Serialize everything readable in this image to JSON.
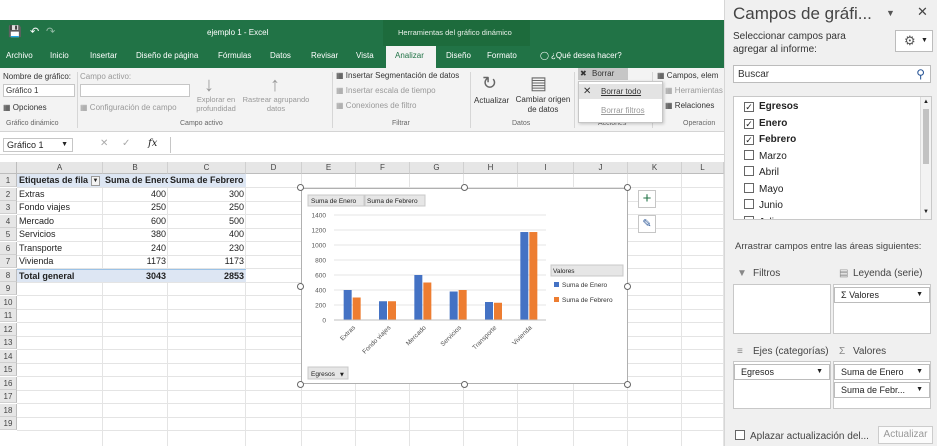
{
  "titlebar": {
    "doc": "ejemplo 1 - Excel",
    "context": "Herramientas del gráfico dinámico"
  },
  "tabs": [
    "Archivo",
    "Inicio",
    "Insertar",
    "Diseño de página",
    "Fórmulas",
    "Datos",
    "Revisar",
    "Vista",
    "Analizar",
    "Diseño",
    "Formato"
  ],
  "tell_me": "¿Qué desea hacer?",
  "ribbon": {
    "chart_name_label": "Nombre de gráfico:",
    "chart_name": "Gráfico 1",
    "options": "Opciones",
    "group_chart": "Gráfico dinámico",
    "active_field_label": "Campo activo:",
    "field_config": "Configuración de campo",
    "explore_down": "Explorar en profundidad",
    "explore_up": "Rastrear agrupando datos",
    "group_active": "Campo activo",
    "slicer": "Insertar Segmentación de datos",
    "timeline": "Insertar escala de tiempo",
    "filter_conn": "Conexiones de filtro",
    "group_filter": "Filtrar",
    "refresh": "Actualizar",
    "change_source": "Cambiar origen de datos",
    "group_data": "Datos",
    "clear": "Borrar",
    "clear_all": "Borrar todo",
    "clear_filters": "Borrar filtros",
    "group_actions": "Acciones",
    "fields_items": "Campos, elem",
    "olap": "Herramientas O",
    "relations": "Relaciones",
    "group_calc": "Operacion"
  },
  "formula": {
    "namebox": "Gráfico 1",
    "fx": "fx"
  },
  "columns": [
    "A",
    "B",
    "C",
    "D",
    "E",
    "F",
    "G",
    "H",
    "I",
    "J",
    "K",
    "L"
  ],
  "rows": [
    "1",
    "2",
    "3",
    "4",
    "5",
    "6",
    "7",
    "8",
    "9",
    "10",
    "11",
    "12",
    "13",
    "14",
    "15",
    "16",
    "17",
    "18",
    "19"
  ],
  "pivot": {
    "headers": [
      "Etiquetas de fila",
      "Suma de Enero",
      "Suma de Febrero"
    ],
    "rows": [
      [
        "Extras",
        "400",
        "300"
      ],
      [
        "Fondo viajes",
        "250",
        "250"
      ],
      [
        "Mercado",
        "600",
        "500"
      ],
      [
        "Servicios",
        "380",
        "400"
      ],
      [
        "Transporte",
        "240",
        "230"
      ],
      [
        "Vivienda",
        "1173",
        "1173"
      ]
    ],
    "total": [
      "Total general",
      "3043",
      "2853"
    ]
  },
  "chart_data": {
    "type": "bar",
    "categories": [
      "Extras",
      "Fondo viajes",
      "Mercado",
      "Servicios",
      "Transporte",
      "Vivienda"
    ],
    "series": [
      {
        "name": "Suma de Enero",
        "values": [
          400,
          250,
          600,
          380,
          240,
          1173
        ],
        "color": "#4472c4"
      },
      {
        "name": "Suma de Febrero",
        "values": [
          300,
          250,
          500,
          400,
          230,
          1173
        ],
        "color": "#ed7d31"
      }
    ],
    "ylim": [
      0,
      1400
    ],
    "yticks": [
      "1400",
      "1200",
      "1000",
      "800",
      "600",
      "400",
      "200",
      "0"
    ],
    "legend_title": "Valores",
    "legend_placement": "right",
    "axis_button": "Egresos",
    "value_buttons": [
      "Suma de Enero",
      "Suma de Febrero"
    ]
  },
  "panel": {
    "title": "Campos de gráfi...",
    "choose_label": "Seleccionar campos para agregar al informe:",
    "search_placeholder": "Buscar",
    "fields": [
      {
        "label": "Egresos",
        "checked": true
      },
      {
        "label": "Enero",
        "checked": true
      },
      {
        "label": "Febrero",
        "checked": true
      },
      {
        "label": "Marzo",
        "checked": false
      },
      {
        "label": "Abril",
        "checked": false
      },
      {
        "label": "Mayo",
        "checked": false
      },
      {
        "label": "Junio",
        "checked": false
      },
      {
        "label": "Julio",
        "checked": false
      }
    ],
    "drag_label": "Arrastrar campos entre las áreas siguientes:",
    "filters": "Filtros",
    "legend": "Leyenda (serie)",
    "legend_item": "Valores",
    "axis": "Ejes (categorías)",
    "values": "Valores",
    "axis_item": "Egresos",
    "value_items": [
      "Suma de Enero",
      "Suma de Febr..."
    ],
    "defer": "Aplazar actualización del...",
    "update": "Actualizar"
  }
}
